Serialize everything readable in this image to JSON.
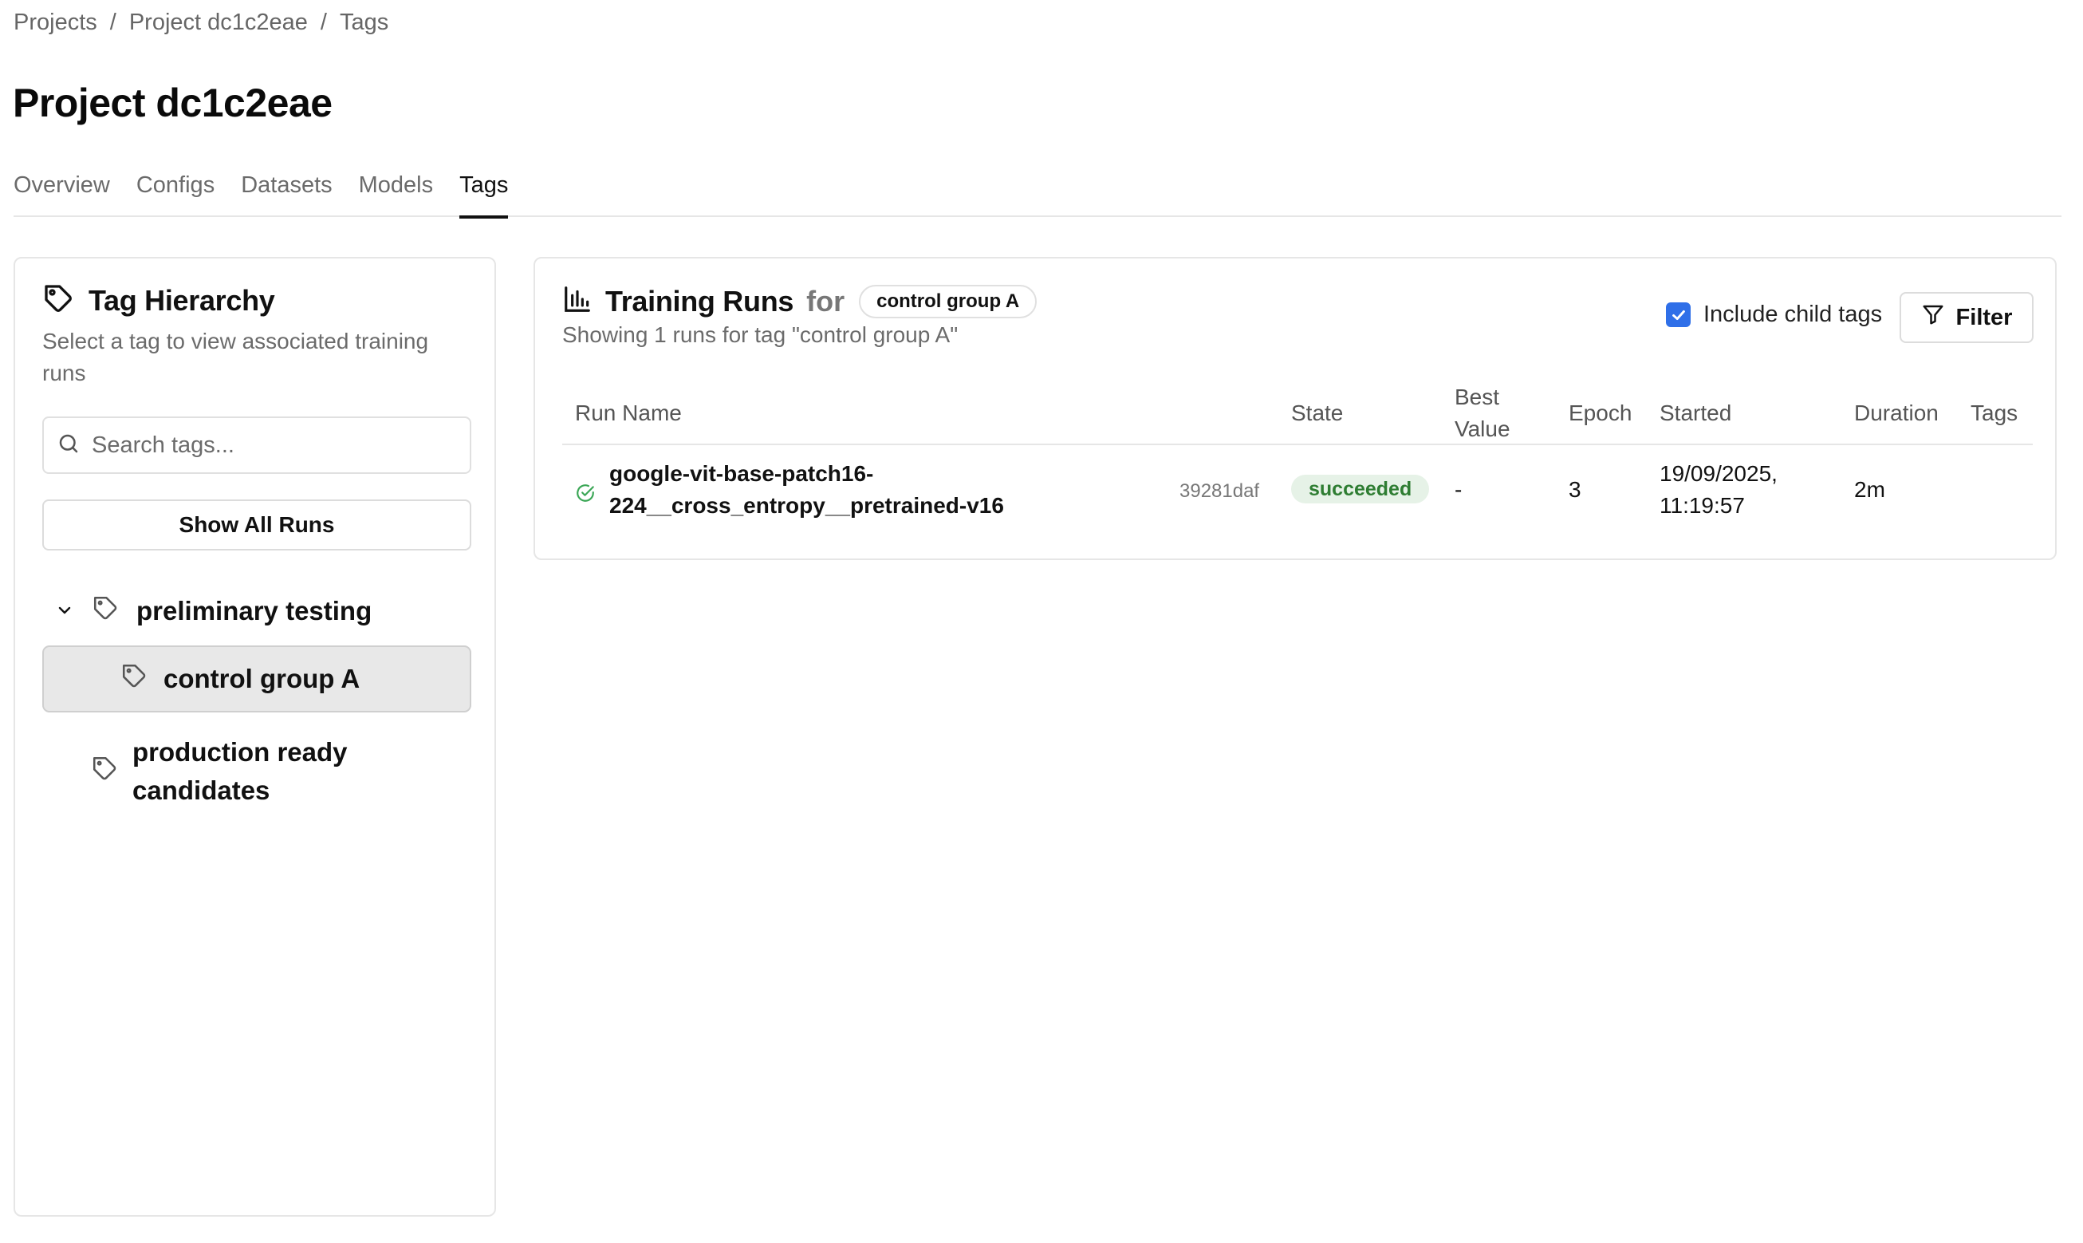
{
  "breadcrumb": {
    "items": [
      "Projects",
      "Project dc1c2eae",
      "Tags"
    ],
    "separator": "/"
  },
  "page": {
    "title": "Project dc1c2eae"
  },
  "tabs": [
    {
      "label": "Overview",
      "active": false
    },
    {
      "label": "Configs",
      "active": false
    },
    {
      "label": "Datasets",
      "active": false
    },
    {
      "label": "Models",
      "active": false
    },
    {
      "label": "Tags",
      "active": true
    }
  ],
  "tag_hierarchy": {
    "title": "Tag Hierarchy",
    "description": "Select a tag to view associated training runs",
    "search_placeholder": "Search tags...",
    "show_all_label": "Show All Runs",
    "tree": {
      "parent": {
        "label": "preliminary testing",
        "expanded": true
      },
      "child_selected": {
        "label": "control group A"
      },
      "sibling": {
        "label_line1": "production ready",
        "label_line2": "candidates"
      }
    }
  },
  "training_runs": {
    "title": "Training Runs",
    "for_label": "for",
    "tag_pill": "control group A",
    "subtitle": "Showing 1 runs for tag \"control group A\"",
    "include_child_tags": {
      "label": "Include child tags",
      "checked": true
    },
    "filter_label": "Filter",
    "columns": {
      "run_name": "Run Name",
      "state": "State",
      "best_value_1": "Best",
      "best_value_2": "Value",
      "epoch": "Epoch",
      "started": "Started",
      "duration": "Duration",
      "tags": "Tags"
    },
    "rows": [
      {
        "name_line1": "google-vit-base-patch16-",
        "name_line2": "224__cross_entropy__pretrained-v16",
        "hash": "39281daf",
        "state": "succeeded",
        "best_value": "-",
        "epoch": "3",
        "started_line1": "19/09/2025,",
        "started_line2": "11:19:57",
        "duration": "2m",
        "tags": ""
      }
    ]
  },
  "colors": {
    "accent": "#2f6fe8",
    "success_text": "#2e7d32",
    "success_bg": "#e6f2e7",
    "selected_bg": "#e8e8e8",
    "border": "#e6e6e6"
  }
}
